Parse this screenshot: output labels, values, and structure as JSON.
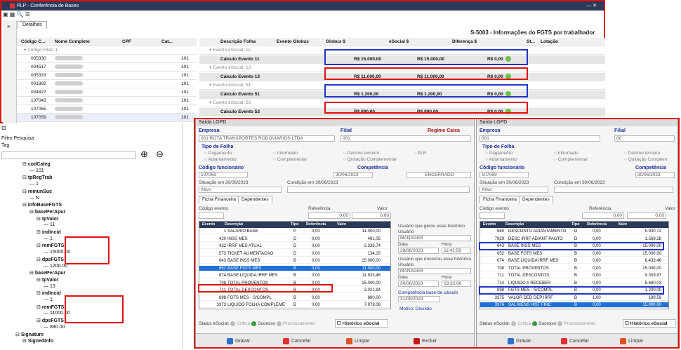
{
  "window": {
    "title": "PLP - Conferência de Bases",
    "tab": "Detalhes",
    "header": "S-5003 - Informações do FGTS por trabalhador"
  },
  "left_grid": {
    "columns": [
      "Código C...",
      "Nome Completo",
      "CPF",
      "Cat..."
    ],
    "group": "Código Filial: 1",
    "rows": [
      [
        "005330",
        "101"
      ],
      [
        "004517",
        "101"
      ],
      [
        "005333",
        "101"
      ],
      [
        "001892",
        "101"
      ],
      [
        "004827",
        "101"
      ],
      [
        "107043",
        "101"
      ],
      [
        "107065",
        "101"
      ],
      [
        "107059",
        "101"
      ]
    ]
  },
  "right_grid": {
    "columns": [
      "Descrição Folha",
      "Evento Globus",
      "Globus $",
      "eSocial $",
      "Diferença $",
      "St...",
      "Lotação"
    ],
    "rows": [
      {
        "type": "group",
        "desc": "Evento eSocial: 11"
      },
      {
        "type": "calc",
        "desc": "Cálculo Evento 11",
        "globus": "R$ 15.000,00",
        "esocial": "R$ 15.000,00",
        "diff": "R$ 0,00"
      },
      {
        "type": "group",
        "desc": "Evento eSocial: 13"
      },
      {
        "type": "calc",
        "desc": "Cálculo Evento 13",
        "globus": "R$ 11.000,00",
        "esocial": "R$ 11.000,00",
        "diff": "R$ 0,00"
      },
      {
        "type": "group",
        "desc": "Evento eSocial: 51"
      },
      {
        "type": "calc",
        "desc": "Cálculo Evento 51",
        "globus": "R$ 1.200,00",
        "esocial": "R$ 1.200,00",
        "diff": "R$ 0,00"
      },
      {
        "type": "group",
        "desc": "Evento eSocial: 53"
      },
      {
        "type": "calc",
        "desc": "Cálculo Evento 53",
        "globus": "R$ 880,00",
        "esocial": "R$ 880,00",
        "diff": "R$ 0,00"
      }
    ]
  },
  "tree": {
    "filtro": "Filtro Pesquisa",
    "tag": "Tag",
    "nodes": [
      {
        "t": "codCateg",
        "b": 1,
        "d": 1
      },
      {
        "t": "101",
        "b": 0,
        "d": 2
      },
      {
        "t": "tpRegTrab",
        "b": 1,
        "d": 1
      },
      {
        "t": "1",
        "b": 0,
        "d": 2
      },
      {
        "t": "remunSuc",
        "b": 1,
        "d": 1
      },
      {
        "t": "N",
        "b": 0,
        "d": 2
      },
      {
        "t": "infoBaseFGTS",
        "b": 1,
        "d": 1
      },
      {
        "t": "basePerApur",
        "b": 1,
        "d": 2
      },
      {
        "t": "tpValor",
        "b": 1,
        "d": 3
      },
      {
        "t": "11",
        "b": 0,
        "d": 4
      },
      {
        "t": "indIncid",
        "b": 1,
        "d": 3
      },
      {
        "t": "1",
        "b": 0,
        "d": 4
      },
      {
        "t": "remFGTS",
        "b": 1,
        "d": 3
      },
      {
        "t": "15000.00",
        "b": 0,
        "d": 4
      },
      {
        "t": "dpsFGTS",
        "b": 1,
        "d": 3
      },
      {
        "t": "1200.00",
        "b": 0,
        "d": 4
      },
      {
        "t": "basePerApur",
        "b": 1,
        "d": 2
      },
      {
        "t": "tpValor",
        "b": 1,
        "d": 3
      },
      {
        "t": "13",
        "b": 0,
        "d": 4
      },
      {
        "t": "indIncid",
        "b": 1,
        "d": 3
      },
      {
        "t": "1",
        "b": 0,
        "d": 4
      },
      {
        "t": "remFGTS",
        "b": 1,
        "d": 3
      },
      {
        "t": "11000.00",
        "b": 0,
        "d": 4
      },
      {
        "t": "dpsFGTS",
        "b": 1,
        "d": 3
      },
      {
        "t": "880.00",
        "b": 0,
        "d": 4
      },
      {
        "t": "Signature",
        "b": 1,
        "d": 0
      },
      {
        "t": "SignedInfo",
        "b": 1,
        "d": 1
      }
    ]
  },
  "p1": {
    "title": "Saída LGPD",
    "empresa_lbl": "Empresa",
    "empresa": "001 ROTA TRANSPORTES RODOVIARIOS LTDA",
    "filial_lbl": "Filial",
    "filial": "001",
    "regime": "Regime Caixa",
    "tipo_folha": "Tipo de Folha",
    "radios": [
      "Pagamento",
      "Informado",
      "Décimo terceiro",
      "PLR",
      "Adiantamento",
      "Complementar",
      "Quitação Complementar"
    ],
    "func_lbl": "Código funcionário",
    "func": "107059",
    "comp_lbl": "Competência",
    "comp": "30/06/2023",
    "encerrado": "ENCERRADO",
    "situacao": "Situação em 30/06/2023",
    "condicao": "Condição em 30/06/2023",
    "ativo": "Ativo",
    "tabs": [
      "Ficha Financeira",
      "Dependentes"
    ],
    "cod_evento": "Código evento",
    "referencia": "Referência",
    "valor": "Valor",
    "ref_val": "0,00",
    "val_val": "0,00",
    "cols": [
      "Evento",
      "Descrição",
      "Tipo",
      "Referência",
      "Valor"
    ],
    "rows": [
      [
        "1",
        "SALARIO BASE",
        "P",
        "0,00",
        "11.000,00"
      ],
      [
        "420",
        "INSS MES",
        "D",
        "0,00",
        "491,05"
      ],
      [
        "432",
        "IRRF MES ATUAL",
        "D",
        "0,00",
        "2.336,74"
      ],
      [
        "573",
        "TICKET ALIMENTACAO",
        "D",
        "0,00",
        "134,15"
      ],
      [
        "643",
        "BASE INSS MES",
        "B",
        "0,00",
        "15.000,00"
      ],
      [
        "652",
        "BASE FGTS MES",
        "B",
        "0,00",
        "11.000,00"
      ],
      [
        "674",
        "BASE LIQUIDA IRRF MES",
        "B",
        "0,00",
        "11.933,46"
      ],
      [
        "708",
        "TOTAL PROVENTOS",
        "B",
        "0,00",
        "15.000,00"
      ],
      [
        "711",
        "TOTAL DESCONTOS",
        "B",
        "0,00",
        "3.021,94"
      ],
      [
        "898",
        "FGTS MES - S/COMPL",
        "B",
        "0,00",
        "880,00"
      ],
      [
        "3373",
        "LIQUIDO FOLHA COMPLEME",
        "B",
        "0,00",
        "7.978,06"
      ]
    ],
    "hist1": "Usuário que gerou esse histórico",
    "usuario": "Usuário",
    "user1": "MANAGER",
    "data": "Data",
    "hora": "Hora",
    "d1": "28/06/2023",
    "h1": "11:42:59",
    "hist2": "Usuário que encerrou esse histórico",
    "user2": "MANAGER",
    "d2": "30/06/2023",
    "h2": "18:32:06",
    "compcalc": "Competência base de cálculo",
    "compcalc_v": "31/05/2023",
    "motivo": "Motivo: Dissídio",
    "status": "Status eSocial:",
    "crit": "Crítica",
    "suc": "Sucesso",
    "proc": "Processamento",
    "hist_btn": "Histórico eSocial",
    "btns": [
      "Gravar",
      "Cancelar",
      "Limpar",
      "Excluir"
    ]
  },
  "p2": {
    "title": "Saída LGPD",
    "empresa_lbl": "Empresa",
    "empresa": "001",
    "filial_lbl": "Filial",
    "filial": "00",
    "tipo_folha": "Tipo de Folha",
    "radios": [
      "Pagamento",
      "Informado",
      "Décimo terceiro",
      "Adiantamento",
      "Complementar",
      "Quitação Complem"
    ],
    "func_lbl": "Código funcionário",
    "func": "107059",
    "comp_lbl": "Competência",
    "comp": "30/06/2023",
    "situacao": "Situação em 30/06/2023",
    "condicao": "Condição em 30/06/2023",
    "ativo": "Ativo",
    "tabs": [
      "Ficha Financeira",
      "Dependentes"
    ],
    "cod_evento": "Código evento",
    "referencia": "Referência",
    "valor": "Valor",
    "ref_val": "0,00",
    "val_val": "0,00",
    "cols": [
      "Evento",
      "Descrição",
      "Tipo",
      "Referência",
      "Valor"
    ],
    "rows": [
      [
        "580",
        "DESCONTO ADIANTAMENTO",
        "D",
        "0,00",
        "5.930,72"
      ],
      [
        "7929",
        "DESC IRRF ADIANT PAGTO",
        "D",
        "0,00",
        "1.569,28"
      ],
      [
        "643",
        "BASE INSS MES",
        "B",
        "0,00",
        "15.000,00"
      ],
      [
        "652",
        "BASE FGTS MES",
        "B",
        "0,00",
        "15.000,00"
      ],
      [
        "674",
        "BASE LIQUIDA IRRF MES",
        "B",
        "0,00",
        "6.433,46"
      ],
      [
        "708",
        "TOTAL PROVENTOS",
        "B",
        "0,00",
        "15.000,00"
      ],
      [
        "711",
        "TOTAL DESCONTOS",
        "B",
        "0,00",
        "9.309,97"
      ],
      [
        "714",
        "LIQUIDO A RECEBER",
        "B",
        "0,00",
        "5.690,03"
      ],
      [
        "898",
        "FGTS MES - S/COMPL",
        "B",
        "0,00",
        "1.200,00"
      ],
      [
        "3375",
        "VALOR DED DEP IRRF",
        "B",
        "1,00",
        "189,59"
      ],
      [
        "3376",
        "SAL MENS HIST FINC",
        "B",
        "0,00",
        "15.000,00"
      ]
    ],
    "status": "Status eSocial:",
    "crit": "Crítica",
    "suc": "Sucesso",
    "proc": "Processamento",
    "hist_btn": "Histórico eSocial",
    "btns": [
      "Gravar",
      "Cancelar",
      "Limpar"
    ]
  }
}
